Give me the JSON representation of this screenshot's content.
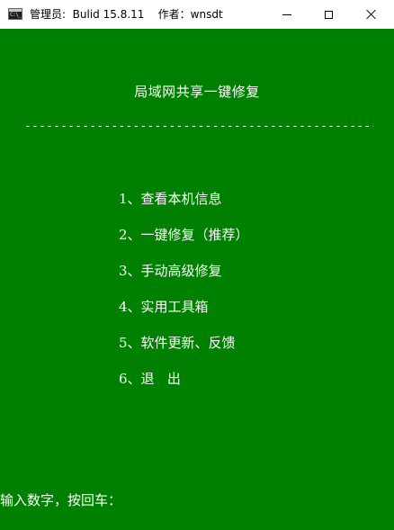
{
  "window": {
    "title": "管理员:  Bulid 15.8.11    作者：wnsdt",
    "icon_name": "console-app-icon",
    "icon_glyph": "C:\\_"
  },
  "console": {
    "background_color": "#008000",
    "text_color": "#ffffff",
    "title": "局域网共享一键修复",
    "separator": "------------------------------------------------------------",
    "menu": [
      {
        "number": "1、",
        "label": "查看本机信息"
      },
      {
        "number": "2、",
        "label": "一键修复（推荐）"
      },
      {
        "number": "3、",
        "label": "手动高级修复"
      },
      {
        "number": "4、",
        "label": "实用工具箱"
      },
      {
        "number": "5、",
        "label": "软件更新、反馈"
      },
      {
        "number": "6、",
        "label": "退   出"
      }
    ],
    "prompt": "输入数字，按回车："
  }
}
